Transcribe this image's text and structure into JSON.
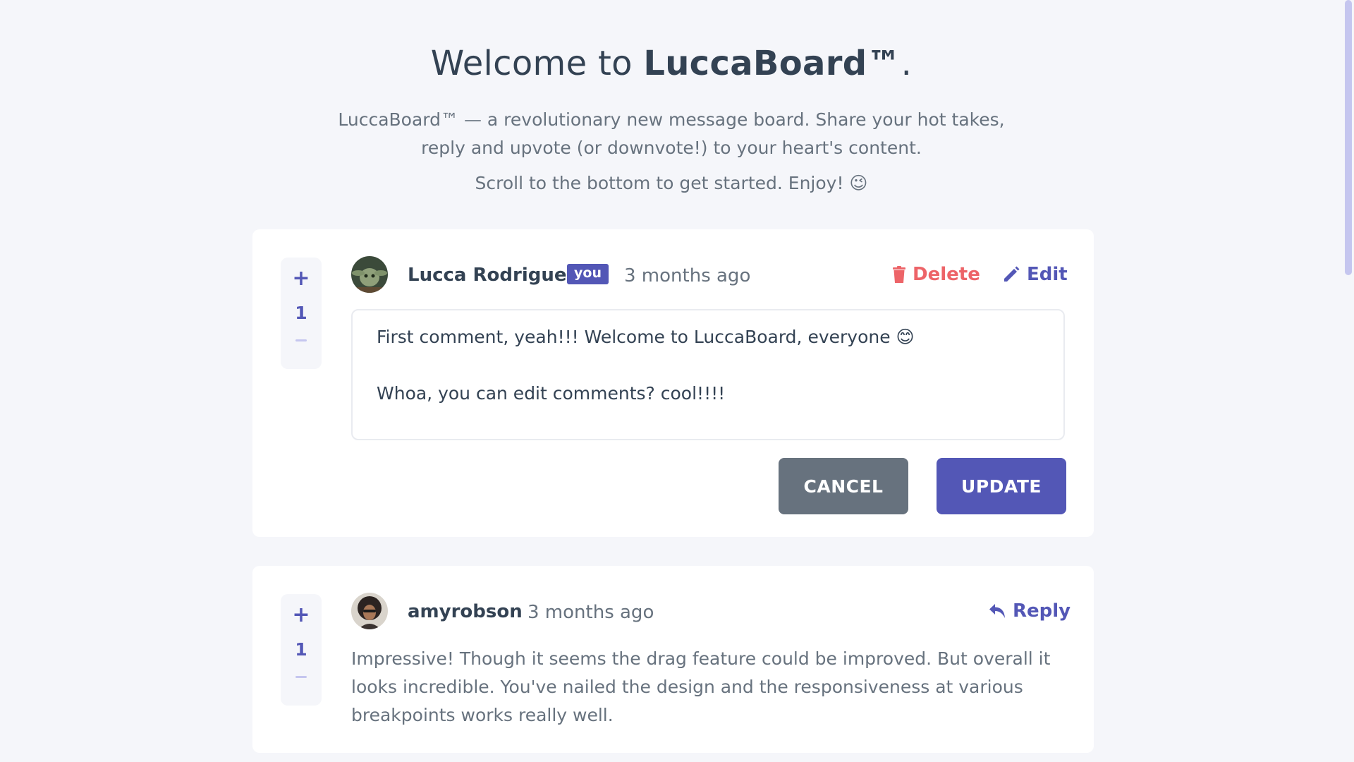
{
  "intro": {
    "title_prefix": "Welcome to ",
    "title_brand": "LuccaBoard™",
    "title_suffix": ".",
    "line1": "LuccaBoard™ — a revolutionary new message board. Share your hot takes,",
    "line2": "reply and upvote (or downvote!) to your heart's content.",
    "line3": "Scroll to the bottom to get started. Enjoy! 😉"
  },
  "comments": [
    {
      "score": "1",
      "plus": "+",
      "author": "Lucca Rodrigues",
      "badge": "you",
      "time": "3 months ago",
      "delete_label": "Delete",
      "edit_label": "Edit",
      "edit_text": "First comment, yeah!!! Welcome to LuccaBoard, everyone 😊\n\nWhoa, you can edit comments? cool!!!!",
      "cancel_label": "CANCEL",
      "update_label": "UPDATE"
    },
    {
      "score": "1",
      "plus": "+",
      "author": "amyrobson",
      "time": "3 months ago",
      "reply_label": "Reply",
      "text": "Impressive! Though it seems the drag feature could be improved. But overall it looks incredible. You've nailed the design and the responsiveness at various breakpoints works really well."
    }
  ],
  "colors": {
    "background": "#f5f6fa",
    "primary": "#5357b6",
    "danger": "#ed6468",
    "neutral": "#67727e",
    "dark_text": "#334253"
  },
  "icons": [
    "plus-icon",
    "minus-icon",
    "trash-icon",
    "pencil-icon",
    "reply-arrow-icon"
  ]
}
